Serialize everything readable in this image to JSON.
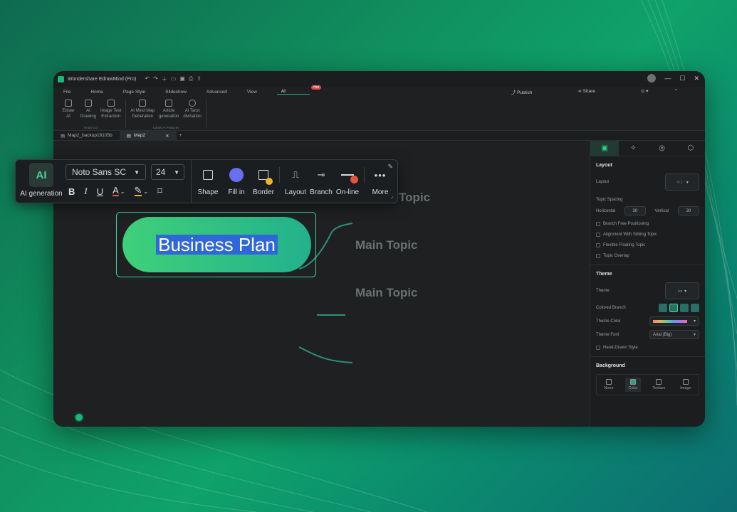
{
  "window": {
    "title": "Wondershare EdrawMind (Pro)",
    "controls": [
      "—",
      "☐",
      "✕"
    ]
  },
  "menu": {
    "items": [
      "File",
      "Home",
      "Page Style",
      "Slideshow",
      "Advanced",
      "View"
    ],
    "active": "AI",
    "badge": "Hot",
    "publish": "Publish",
    "share": "Share"
  },
  "ribbon": {
    "smart_tool": {
      "label": "smart tool",
      "buttons": [
        {
          "line1": "Edraw",
          "line2": "AI"
        },
        {
          "line1": "AI",
          "line2": "Drawing"
        },
        {
          "line1": "Image Text",
          "line2": "Extraction"
        }
      ]
    },
    "features": {
      "label": "Edraw AI Features",
      "buttons": [
        {
          "line1": "AI Mind Map",
          "line2": "Generation"
        },
        {
          "line1": "Article",
          "line2": "generation"
        },
        {
          "line1": "AI Tarot",
          "line2": "divination"
        }
      ]
    }
  },
  "doc_tabs": [
    {
      "label": "Map2_backup18105b"
    },
    {
      "label": "Map2"
    }
  ],
  "floating_toolbar": {
    "ai_label": "AI generation",
    "ai_icon_text": "AI",
    "font": "Noto Sans SC",
    "size": "24",
    "bold": "B",
    "italic": "I",
    "underline": "U",
    "font_color": "A",
    "tools": [
      {
        "label": "Shape"
      },
      {
        "label": "Fill in"
      },
      {
        "label": "Border"
      },
      {
        "label": "Layout"
      },
      {
        "label": "Branch"
      },
      {
        "label": "On-line"
      },
      {
        "label": "More"
      }
    ],
    "colors": {
      "fill": "#6a6ff0",
      "border_dot": "#f0b429",
      "online_dot": "#e8533d",
      "font_underline": "#e8533d",
      "highlight": "#f0b429"
    }
  },
  "mindmap": {
    "central": "Business Plan",
    "topics": [
      "Main Topic",
      "Main Topic",
      "Topic"
    ]
  },
  "panel": {
    "layout": {
      "title": "Layout",
      "layout_label": "Layout",
      "spacing_label": "Topic Spacing",
      "horizontal_label": "Horizontal",
      "horizontal_value": "30",
      "vertical_label": "Vertical",
      "vertical_value": "30",
      "options": [
        "Branch Free Positioning",
        "Alignment With Sibling Topic",
        "Flexible Floating Topic",
        "Topic Overlap"
      ]
    },
    "theme": {
      "title": "Theme",
      "theme_label": "Theme",
      "colored_branch_label": "Colored Branch",
      "theme_color_label": "Theme Color",
      "theme_font_label": "Theme Font",
      "theme_font_value": "Arial (Big)",
      "hand_drawn": "Hand-Drawn Style"
    },
    "background": {
      "title": "Background",
      "options": [
        "None",
        "Color",
        "Texture",
        "Image"
      ]
    }
  }
}
